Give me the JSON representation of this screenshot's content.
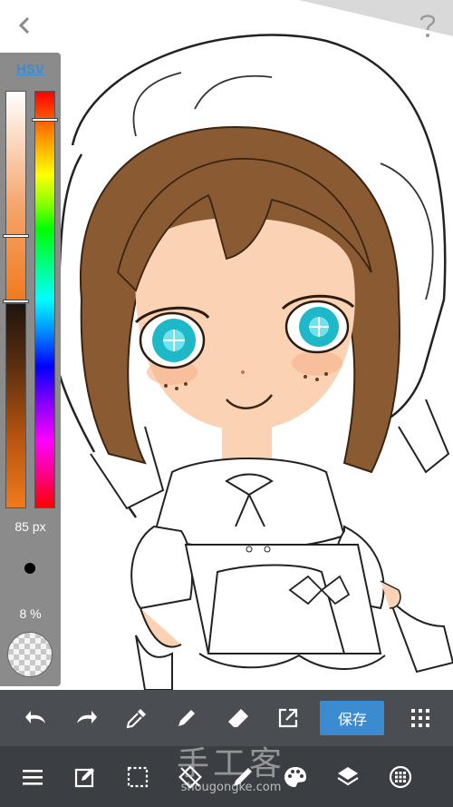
{
  "top_bar": {
    "back_icon": "chevron-left-icon",
    "help_icon": "question-mark-icon"
  },
  "color_panel": {
    "mode_label": "HSV",
    "brush_size": "85 px",
    "opacity": "8 %",
    "selected_hue_fraction": 0.07,
    "current_color": "#f07a1c",
    "accent_color": "#2f8fe0"
  },
  "upper_toolbar": {
    "tools": [
      "undo-icon",
      "redo-icon",
      "eyedropper-icon",
      "pen-icon",
      "eraser-icon",
      "export-icon"
    ],
    "save_label": "保存",
    "grid_icon": "grid-menu-icon"
  },
  "lower_toolbar": {
    "tools": [
      "menu-icon",
      "edit-layer-icon",
      "selection-icon",
      "transform-icon",
      "brush-icon",
      "palette-icon",
      "layers-icon",
      "settings-circle-icon"
    ]
  },
  "watermark": {
    "text": "手工客",
    "url": "shougongke.com"
  }
}
